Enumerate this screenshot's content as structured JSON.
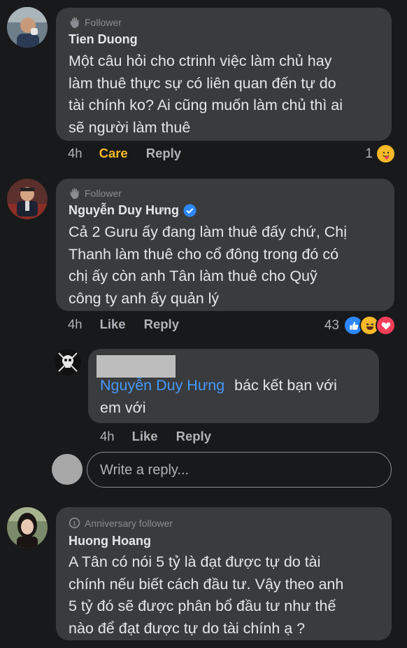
{
  "comments": [
    {
      "badge": "Follower",
      "author": "Tien Duong",
      "lines": [
        "Một câu hỏi cho ctrinh việc làm chủ hay",
        "làm thuê thực sự có liên quan đến tự do",
        "tài chính ko? Ai cũng muốn làm chủ thì ai",
        "sẽ người làm thuê"
      ],
      "time": "4h",
      "reaction_label": "Care",
      "reply_label": "Reply",
      "reaction_count": "1"
    },
    {
      "badge": "Follower",
      "author": "Nguyễn Duy Hưng",
      "verified": true,
      "lines": [
        "Cả 2 Guru ấy đang làm thuê đấy chứ, Chị",
        "Thanh làm thuê cho cổ đông trong đó có",
        "chị ấy còn anh Tân làm thuê cho Quỹ",
        "công ty anh ấy quản lý"
      ],
      "time": "4h",
      "reaction_label": "Like",
      "reply_label": "Reply",
      "reaction_count": "43"
    }
  ],
  "reply": {
    "mention": "Nguyễn Duy Hưng",
    "text_line1": "bác kết bạn với",
    "text_line2": "em với",
    "time": "4h",
    "like_label": "Like",
    "reply_label": "Reply"
  },
  "write_reply": {
    "placeholder": "Write a reply..."
  },
  "comment3": {
    "badge": "Anniversary follower",
    "author": "Huong Hoang",
    "lines": [
      "A Tân có nói 5 tỷ là đạt được tự do tài",
      "chính nếu biết cách đầu tư. Vậy theo anh",
      "5 tỷ đó sẽ được phân bổ đầu tư như thế",
      "nào để đạt được tự do tài chính ạ ?"
    ]
  },
  "colors": {
    "background": "#18191a",
    "bubble": "#3a3b3c",
    "care": "#f7b928",
    "mention": "#4599ff",
    "verified": "#2d88ff"
  }
}
